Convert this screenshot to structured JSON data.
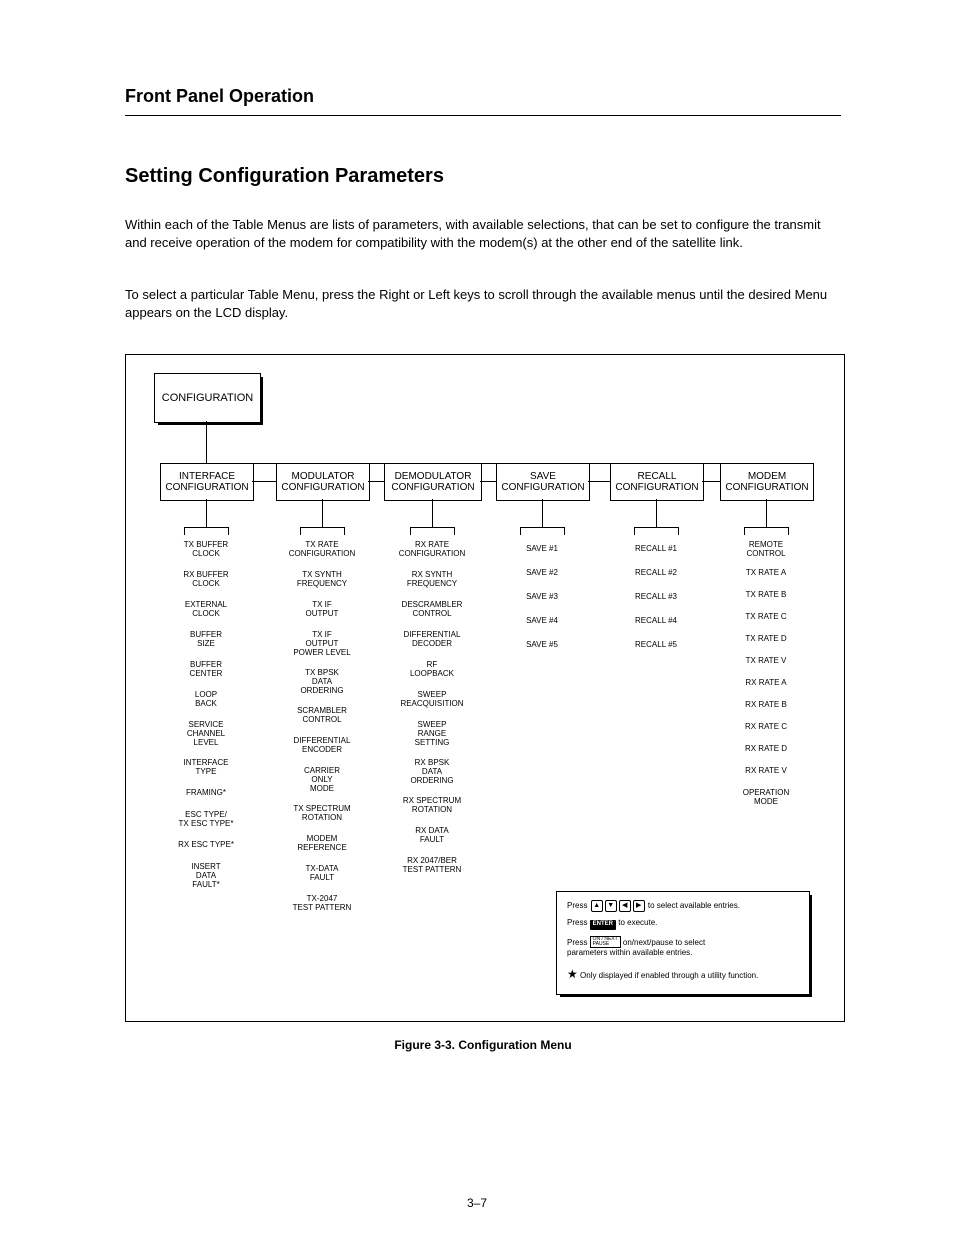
{
  "header": {
    "title": "Front Panel Operation"
  },
  "section": {
    "title": "Setting Configuration Parameters",
    "para1": "Within each of the Table Menus are lists of parameters, with available selections, that can be set to configure the transmit and receive operation of the modem for compatibility with the modem(s) at the other end of the satellite link.",
    "para2": "To select a particular Table Menu, press the Right or Left keys to scroll through the available menus until the desired Menu appears on the LCD display."
  },
  "diagram": {
    "main_box": "CONFIGURATION",
    "menu_boxes": [
      "INTERFACE\nCONFIGURATION",
      "MODULATOR\nCONFIGURATION",
      "DEMODULATOR\nCONFIGURATION",
      "SAVE\nCONFIGURATION",
      "RECALL\nCONFIGURATION",
      "MODEM\nCONFIGURATION"
    ],
    "columns": [
      {
        "items": [
          "TX BUFFER\nCLOCK",
          "RX BUFFER\nCLOCK",
          "EXTERNAL\nCLOCK",
          "BUFFER\nSIZE",
          "BUFFER\nCENTER",
          "LOOP\nBACK",
          "SERVICE\nCHANNEL\nLEVEL",
          "INTERFACE\nTYPE",
          "FRAMING*",
          "ESC TYPE/\nTX ESC TYPE*",
          "RX ESC TYPE*",
          "INSERT\nDATA\nFAULT*"
        ]
      },
      {
        "items": [
          "TX RATE\nCONFIGURATION",
          "TX SYNTH\nFREQUENCY",
          "TX IF\nOUTPUT",
          "TX IF\nOUTPUT\nPOWER LEVEL",
          "TX BPSK\nDATA\nORDERING",
          "SCRAMBLER\nCONTROL",
          "DIFFERENTIAL\nENCODER",
          "CARRIER\nONLY\nMODE",
          "TX SPECTRUM\nROTATION",
          "MODEM\nREFERENCE",
          "TX-DATA\nFAULT",
          "TX-2047\nTEST PATTERN"
        ]
      },
      {
        "items": [
          "RX RATE\nCONFIGURATION",
          "RX SYNTH\nFREQUENCY",
          "DESCRAMBLER\nCONTROL",
          "DIFFERENTIAL\nDECODER",
          "RF\nLOOPBACK",
          "SWEEP\nREACQUISITION",
          "SWEEP\nRANGE\nSETTING",
          "RX BPSK\nDATA\nORDERING",
          "RX SPECTRUM\nROTATION",
          "RX DATA\nFAULT",
          "RX 2047/BER\nTEST PATTERN"
        ]
      },
      {
        "items": [
          "SAVE #1",
          "SAVE #2",
          "SAVE #3",
          "SAVE #4",
          "SAVE #5"
        ]
      },
      {
        "items": [
          "RECALL #1",
          "RECALL #2",
          "RECALL #3",
          "RECALL #4",
          "RECALL #5"
        ]
      },
      {
        "items": [
          "REMOTE\nCONTROL",
          "TX RATE A",
          "TX RATE B",
          "TX RATE C",
          "TX RATE D",
          "TX RATE V",
          "RX RATE A",
          "RX RATE B",
          "RX RATE C",
          "RX RATE D",
          "RX RATE V",
          "OPERATION\nMODE"
        ]
      }
    ],
    "legend": {
      "line1": "Press                  to select available entries.",
      "line2": "Press                  to execute.",
      "line3_a": "Press                  on/next/pause to select",
      "line3_b": "parameters within available entries.",
      "star_note": "Only displayed if enabled through a utility function."
    }
  },
  "figure_caption": "Figure 3-3. Configuration Menu",
  "page_number": "3–7"
}
